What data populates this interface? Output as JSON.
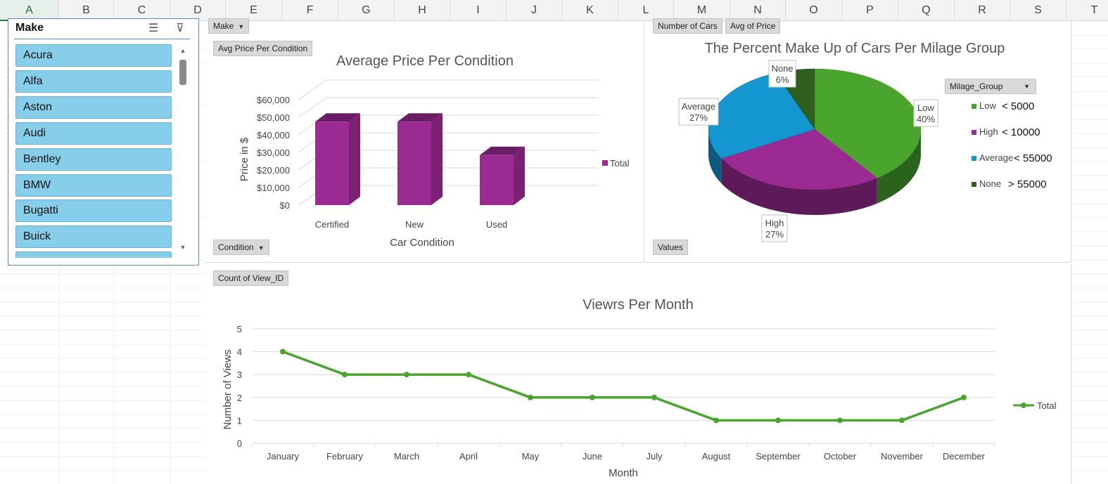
{
  "columns": [
    "A",
    "B",
    "C",
    "D",
    "E",
    "F",
    "G",
    "H",
    "I",
    "J",
    "K",
    "L",
    "M",
    "N",
    "O",
    "P",
    "Q",
    "R",
    "S",
    "T"
  ],
  "slicer": {
    "title": "Make",
    "items": [
      "Acura",
      "Alfa",
      "Aston",
      "Audi",
      "Bentley",
      "BMW",
      "Bugatti",
      "Buick",
      ""
    ]
  },
  "bar_panel": {
    "field_make": "Make",
    "field_value": "Avg Price Per Condition",
    "field_axis": "Condition",
    "legend": "Total"
  },
  "pie_panel": {
    "field_count": "Number of Cars",
    "field_avg": "Avg of Price",
    "field_values": "Values",
    "legend_filter": "Milage_Group",
    "callouts": [
      {
        "name": "Low",
        "pct": "40%"
      },
      {
        "name": "High",
        "pct": "27%"
      },
      {
        "name": "Average",
        "pct": "27%"
      },
      {
        "name": "None",
        "pct": "6%"
      }
    ],
    "legend": [
      {
        "name": "Low",
        "note": "< 5000",
        "color": "#4aa52e"
      },
      {
        "name": "High",
        "note": "< 10000",
        "color": "#9b2a93"
      },
      {
        "name": "Average",
        "note": "< 55000",
        "color": "#1496d0"
      },
      {
        "name": "None",
        "note": "> 55000",
        "color": "#2f5e1f"
      }
    ]
  },
  "line_panel": {
    "field_value": "Count of View_ID",
    "legend": "Total"
  },
  "chart_data": [
    {
      "type": "bar",
      "title": "Average Price Per Condition",
      "xlabel": "Car Condition",
      "ylabel": "Price in $",
      "categories": [
        "Certified",
        "New",
        "Used"
      ],
      "series": [
        {
          "name": "Total",
          "values": [
            51500,
            51500,
            32500
          ]
        }
      ],
      "ylim": [
        0,
        60000
      ],
      "yticks": [
        "$0",
        "$10,000",
        "$20,000",
        "$30,000",
        "$40,000",
        "$50,000",
        "$60,000"
      ],
      "color": "#9b2a93",
      "grid": true,
      "legend": "right"
    },
    {
      "type": "pie",
      "title": "The Percent Make Up of Cars Per Milage Group",
      "labels": [
        "Low",
        "High",
        "Average",
        "None"
      ],
      "values": [
        40,
        27,
        27,
        6
      ],
      "colors": [
        "#4aa52e",
        "#9b2a93",
        "#1496d0",
        "#2f5e1f"
      ],
      "legend": "right"
    },
    {
      "type": "line",
      "title": "Viewrs Per Month",
      "xlabel": "Month",
      "ylabel": "Number of Views",
      "categories": [
        "January",
        "February",
        "March",
        "April",
        "May",
        "June",
        "July",
        "August",
        "September",
        "October",
        "November",
        "December"
      ],
      "series": [
        {
          "name": "Total",
          "values": [
            4,
            3,
            3,
            3,
            2,
            2,
            2,
            1,
            1,
            1,
            1,
            2
          ]
        }
      ],
      "ylim": [
        0,
        5
      ],
      "yticks": [
        "0",
        "1",
        "2",
        "3",
        "4",
        "5"
      ],
      "color": "#4aa52e",
      "grid": true,
      "legend": "right"
    }
  ]
}
